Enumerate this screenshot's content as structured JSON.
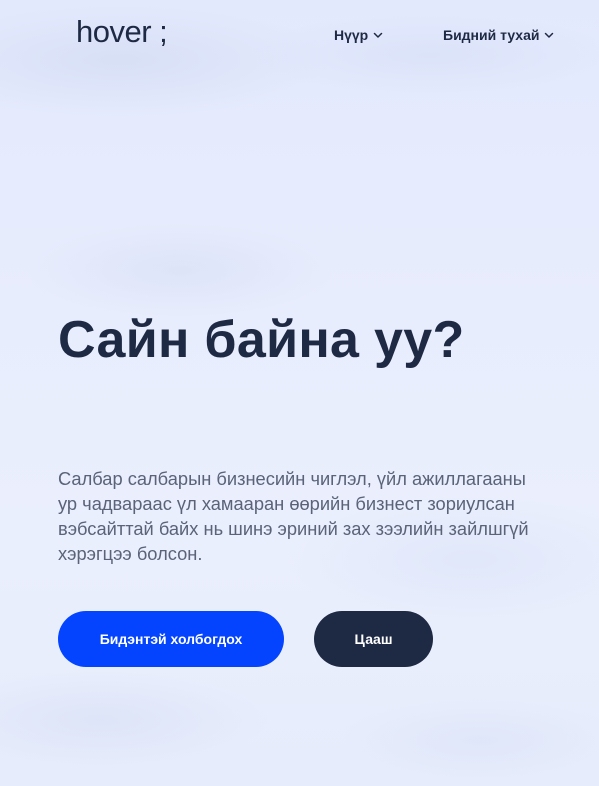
{
  "header": {
    "logo_text": "hover ;",
    "nav": [
      {
        "label": "Нүүр",
        "icon": "chevron-down-icon"
      },
      {
        "label": "Бидний тухай",
        "icon": "chevron-down-icon"
      }
    ]
  },
  "hero": {
    "title": "Сайн байна уу?",
    "description": "Салбар салбарын бизнесийн чиглэл, үйл ажиллагааны ур чадвараас үл хамааран өөрийн бизнест зориулсан вэбсайттай байх нь шинэ эриний зах зээлийн зайлшгүй хэрэгцээ болсон.",
    "primary_button": "Бидэнтэй холбогдох",
    "secondary_button": "Цааш"
  },
  "colors": {
    "accent": "#0444ff",
    "dark": "#1e2a44",
    "text_muted": "#5a6378",
    "background": "#e6ecfd"
  }
}
